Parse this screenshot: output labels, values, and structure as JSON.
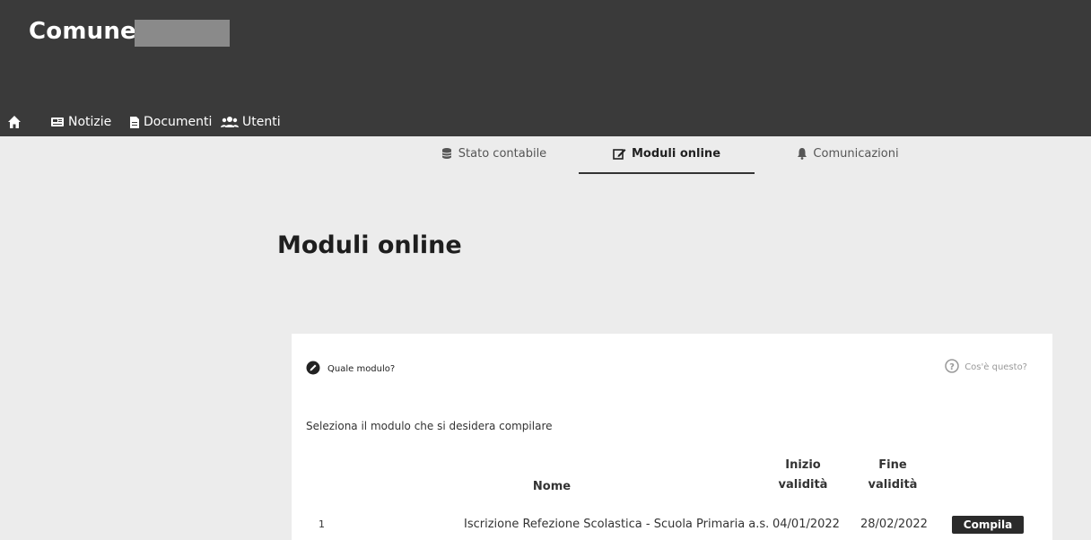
{
  "header": {
    "site_title": "Comune di",
    "nav": [
      {
        "label": "",
        "icon": "home-icon"
      },
      {
        "label": "Notizie",
        "icon": "newspaper-icon"
      },
      {
        "label": "Documenti",
        "icon": "document-icon"
      },
      {
        "label": "Utenti",
        "icon": "users-icon"
      }
    ]
  },
  "tabs": [
    {
      "label": "Stato contabile",
      "icon": "coins-icon",
      "active": false
    },
    {
      "label": "Moduli online",
      "icon": "edit-icon",
      "active": true
    },
    {
      "label": "Comunicazioni",
      "icon": "bell-icon",
      "active": false
    }
  ],
  "page": {
    "title": "Moduli online"
  },
  "card": {
    "question": "Quale modulo?",
    "help_link": "Cos'è questo?",
    "instruction": "Seleziona il modulo che si desidera compilare",
    "columns": {
      "nome": "Nome",
      "inizio": "Inizio validità",
      "fine": "Fine validità"
    },
    "rows": [
      {
        "index": "1",
        "name": "Iscrizione Refezione Scolastica - Scuola Primaria a.s.",
        "inizio": "04/01/2022",
        "fine": "28/02/2022",
        "action": "Compila"
      }
    ]
  },
  "colors": {
    "header_bg": "#3a3a3a",
    "page_bg": "#ececec",
    "card_bg": "#ffffff",
    "button_bg": "#2b2b2b"
  }
}
